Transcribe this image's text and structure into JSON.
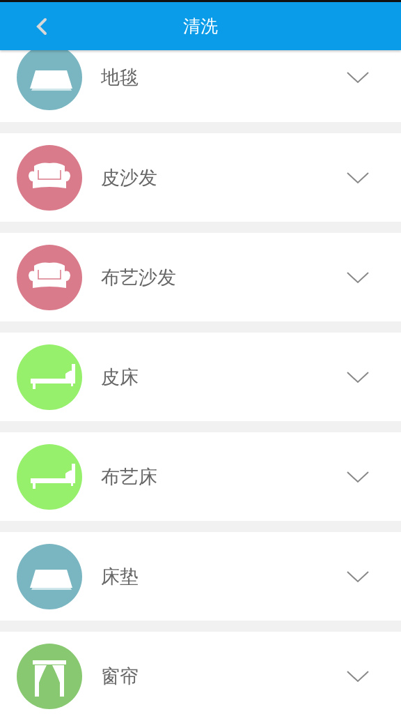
{
  "header": {
    "title": "清洗"
  },
  "items": [
    {
      "label": "地毯",
      "kind": "mat",
      "color": "#7ab6c1"
    },
    {
      "label": "皮沙发",
      "kind": "sofa",
      "color": "#d97b8b"
    },
    {
      "label": "布艺沙发",
      "kind": "sofa",
      "color": "#d97b8b"
    },
    {
      "label": "皮床",
      "kind": "bed",
      "color": "#96f06c"
    },
    {
      "label": "布艺床",
      "kind": "bed",
      "color": "#96f06c"
    },
    {
      "label": "床垫",
      "kind": "mat",
      "color": "#7ab6c1"
    },
    {
      "label": "窗帘",
      "kind": "curtain",
      "color": "#88c870"
    }
  ]
}
